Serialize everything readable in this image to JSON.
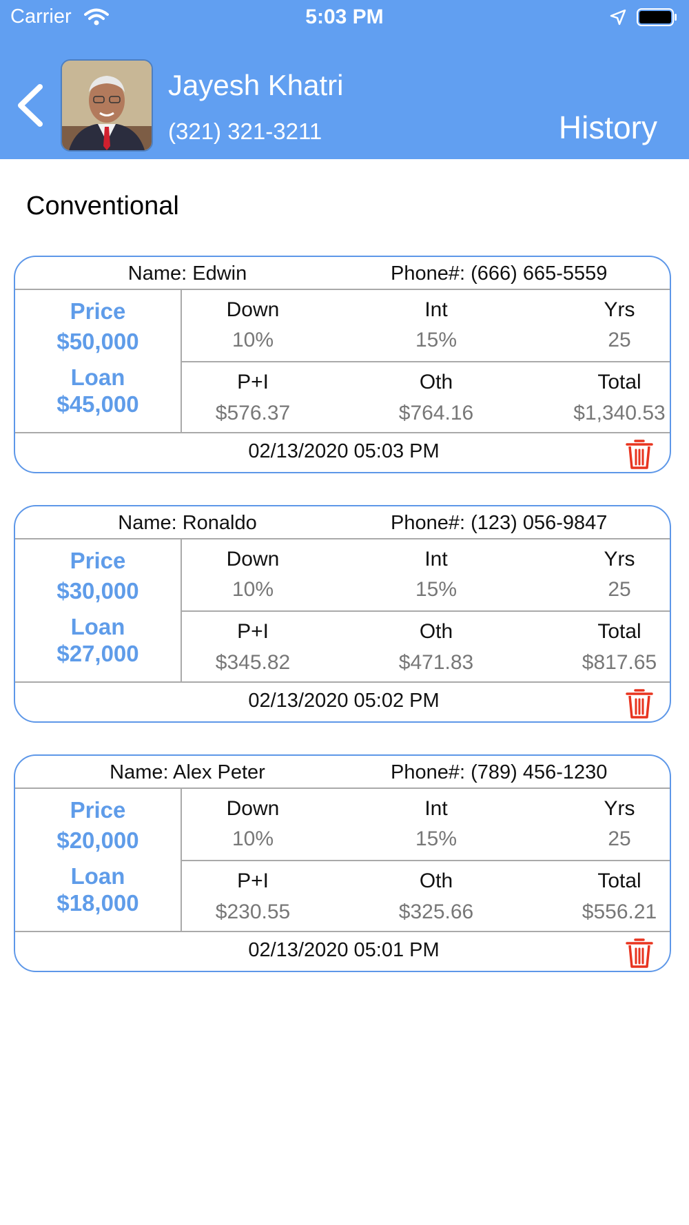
{
  "status_bar": {
    "carrier": "Carrier",
    "time": "5:03 PM"
  },
  "header": {
    "agent_name": "Jayesh Khatri",
    "agent_phone": "(321) 321-3211",
    "title": "History"
  },
  "section_title": "Conventional",
  "labels": {
    "price": "Price",
    "loan": "Loan",
    "down": "Down",
    "int": "Int",
    "yrs": "Yrs",
    "pi": "P+I",
    "oth": "Oth",
    "total": "Total"
  },
  "records": [
    {
      "name": "Name: Edwin",
      "phone": "Phone#: (666) 665-5559",
      "price": "$50,000",
      "loan": "$45,000",
      "down": "10%",
      "int": "15%",
      "yrs": "25",
      "pi": "$576.37",
      "oth": "$764.16",
      "total": "$1,340.53",
      "date": "02/13/2020 05:03 PM"
    },
    {
      "name": "Name: Ronaldo",
      "phone": "Phone#: (123) 056-9847",
      "price": "$30,000",
      "loan": "$27,000",
      "down": "10%",
      "int": "15%",
      "yrs": "25",
      "pi": "$345.82",
      "oth": "$471.83",
      "total": "$817.65",
      "date": "02/13/2020 05:02 PM"
    },
    {
      "name": "Name: Alex Peter",
      "phone": "Phone#: (789) 456-1230",
      "price": "$20,000",
      "loan": "$18,000",
      "down": "10%",
      "int": "15%",
      "yrs": "25",
      "pi": "$230.55",
      "oth": "$325.66",
      "total": "$556.21",
      "date": "02/13/2020 05:01 PM"
    }
  ],
  "colors": {
    "header_bg": "#619ff1",
    "accent_blue": "#5f9ce9",
    "delete_red": "#e8341f"
  },
  "icons": {
    "back": "chevron-left-icon",
    "delete": "trash-icon",
    "wifi": "wifi-icon",
    "location": "location-arrow-icon",
    "battery": "battery-icon"
  }
}
